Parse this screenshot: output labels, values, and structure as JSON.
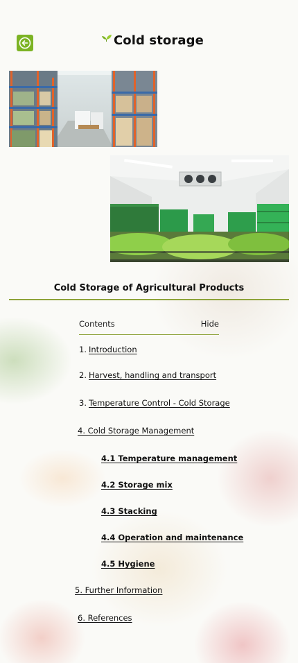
{
  "header": {
    "title": "Cold storage",
    "back_icon": "arrow-left-icon",
    "leaf_icon": "leaf-icon",
    "accent": "#7cb324"
  },
  "images": [
    {
      "name": "warehouse-shelves-photo",
      "alt": "Cold storage warehouse with produce on shelves"
    },
    {
      "name": "cold-room-crates-photo",
      "alt": "Cold room with green crates of vegetables"
    }
  ],
  "article": {
    "heading": "Cold Storage of Agricultural Products",
    "rule_color": "#8ea33a"
  },
  "toc": {
    "contents_label": "Contents",
    "hide_label": "Hide",
    "items": [
      {
        "num": "1.",
        "label": "Introduction"
      },
      {
        "num": "2.",
        "label": "Harvest, handling and transport"
      },
      {
        "num": "3.",
        "label": "Temperature Control - Cold Storage"
      },
      {
        "num": "",
        "label": " 4. Cold Storage Management"
      },
      {
        "num": "",
        "label": " 4.1  Temperature management"
      },
      {
        "num": "",
        "label": " 4.2  Storage mix"
      },
      {
        "num": "",
        "label": " 4.3 Stacking"
      },
      {
        "num": "",
        "label": " 4.4 Operation and maintenance"
      },
      {
        "num": "",
        "label": " 4.5 Hygiene"
      },
      {
        "num": "",
        "label": " 5. Further Information"
      },
      {
        "num": "",
        "label": " 6. References"
      }
    ]
  }
}
